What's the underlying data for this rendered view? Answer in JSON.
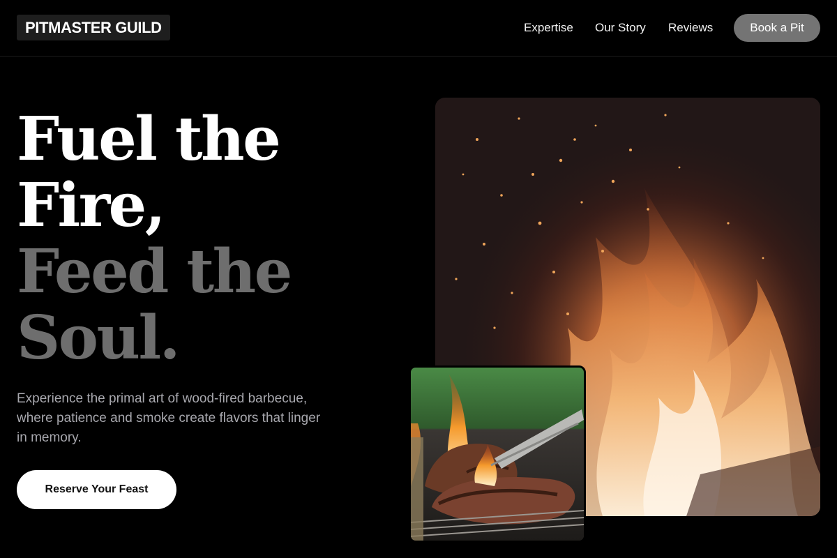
{
  "header": {
    "logo": "PITMASTER GUILD",
    "nav": [
      "Expertise",
      "Our Story",
      "Reviews"
    ],
    "book_label": "Book a Pit"
  },
  "hero": {
    "headline_lines": [
      "Fuel the",
      "Fire,",
      "Feed the",
      "Soul."
    ],
    "subtext": "Experience the primal art of wood-fired barbecue, where patience and smoke create flavors that linger in memory.",
    "cta_label": "Reserve Your Feast"
  },
  "colors": {
    "background": "#000000",
    "headline_primary": "#ffffff",
    "headline_secondary": "#6e6e6e",
    "subtext": "#a8a8ae",
    "book_button": "#747474"
  }
}
